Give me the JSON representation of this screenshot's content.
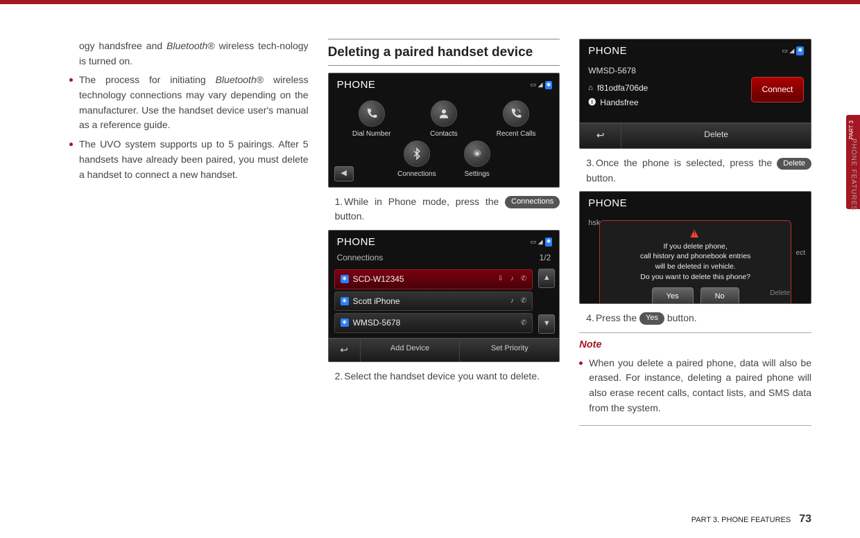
{
  "left": {
    "frag1a": "ogy handsfree and ",
    "frag1b": "Bluetooth",
    "frag1c": "® wireless tech-nology is turned on.",
    "b2a": "The process for initiating ",
    "b2b": "Bluetooth",
    "b2c": "® wireless technology connections may vary depending on the manufacturer. Use the handset device user's manual as a reference guide.",
    "b3": "The UVO system supports up to 5 pairings. After 5 handsets have already been paired, you must delete a handset to connect a new handset."
  },
  "mid": {
    "heading": "Deleting a paired handset device",
    "ss1": {
      "title": "PHONE",
      "icons": [
        "Dial Number",
        "Contacts",
        "Recent Calls",
        "Connections",
        "Settings"
      ]
    },
    "step1a": "While in Phone mode, press the ",
    "step1pill": "Connections",
    "step1b": " button.",
    "ss2": {
      "title": "PHONE",
      "subtitle": "Connections",
      "page": "1/2",
      "rows": [
        "SCD-W12345",
        "Scott iPhone",
        "WMSD-5678"
      ],
      "footer_back": "↩",
      "footer_add": "Add Device",
      "footer_pri": "Set Priority"
    },
    "step2": "Select the handset device you want to delete."
  },
  "right": {
    "ss3": {
      "title": "PHONE",
      "device": "WMSD-5678",
      "line1": "f81odfa706de",
      "line2": "Handsfree",
      "connect": "Connect",
      "back": "↩",
      "delete": "Delete"
    },
    "step3a": "Once the phone is selected, press the ",
    "step3pill": "Delete",
    "step3b": " button.",
    "ss4": {
      "title": "PHONE",
      "hsk": "hsk",
      "dlg1": "If you delete phone,",
      "dlg2": "call history and phonebook entries",
      "dlg3": "will be deleted in vehicle.",
      "dlg4": "Do you want to delete this phone?",
      "yes": "Yes",
      "no": "No",
      "behind_ect": "ect",
      "behind_del": "Delete"
    },
    "step4a": "Press the ",
    "step4pill": "Yes",
    "step4b": " button.",
    "note_h": "Note",
    "note_b": "When you delete a paired phone, data will also be erased. For instance, deleting a paired phone will also erase recent calls, contact lists, and SMS data from the system."
  },
  "side": {
    "part": "PART 3",
    "label": "PHONE FEATURES"
  },
  "footer": {
    "crumb": "PART 3. PHONE FEATURES",
    "page": "73"
  }
}
